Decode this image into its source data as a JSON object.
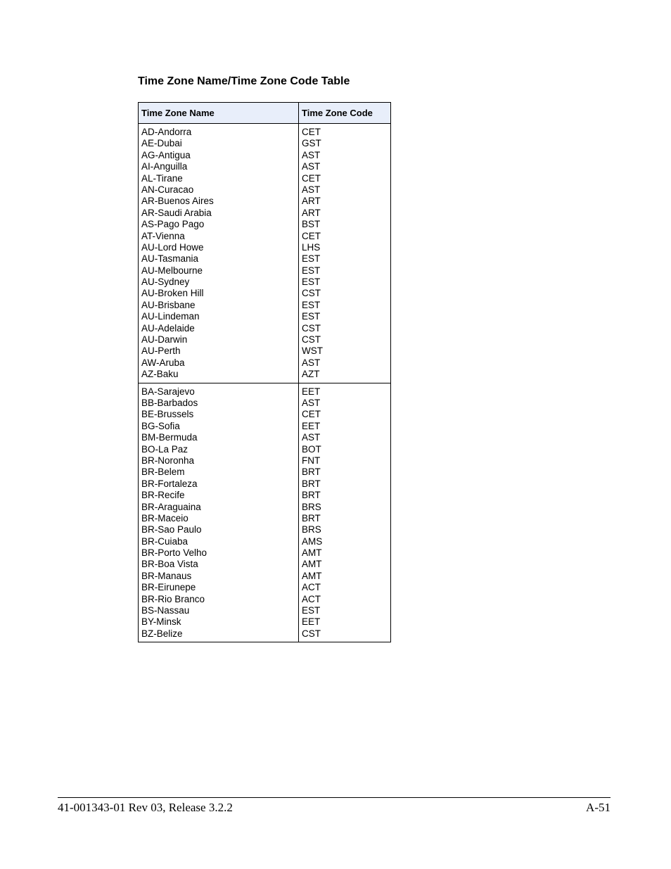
{
  "title": "Time Zone Name/Time Zone Code Table",
  "table": {
    "headers": [
      "Time Zone Name",
      "Time Zone Code"
    ],
    "groups": [
      {
        "rows": [
          {
            "name": "AD-Andorra",
            "code": "CET"
          },
          {
            "name": "AE-Dubai",
            "code": "GST"
          },
          {
            "name": "AG-Antigua",
            "code": "AST"
          },
          {
            "name": "AI-Anguilla",
            "code": "AST"
          },
          {
            "name": "AL-Tirane",
            "code": "CET"
          },
          {
            "name": "AN-Curacao",
            "code": "AST"
          },
          {
            "name": "AR-Buenos Aires",
            "code": "ART"
          },
          {
            "name": "AR-Saudi Arabia",
            "code": "ART"
          },
          {
            "name": "AS-Pago Pago",
            "code": "BST"
          },
          {
            "name": "AT-Vienna",
            "code": "CET"
          },
          {
            "name": "AU-Lord Howe",
            "code": "LHS"
          },
          {
            "name": "AU-Tasmania",
            "code": "EST"
          },
          {
            "name": "AU-Melbourne",
            "code": "EST"
          },
          {
            "name": "AU-Sydney",
            "code": "EST"
          },
          {
            "name": "AU-Broken Hill",
            "code": "CST"
          },
          {
            "name": "AU-Brisbane",
            "code": "EST"
          },
          {
            "name": "AU-Lindeman",
            "code": "EST"
          },
          {
            "name": "AU-Adelaide",
            "code": "CST"
          },
          {
            "name": "AU-Darwin",
            "code": "CST"
          },
          {
            "name": "AU-Perth",
            "code": "WST"
          },
          {
            "name": "AW-Aruba",
            "code": "AST"
          },
          {
            "name": "AZ-Baku",
            "code": "AZT"
          }
        ]
      },
      {
        "rows": [
          {
            "name": "BA-Sarajevo",
            "code": "EET"
          },
          {
            "name": "BB-Barbados",
            "code": "AST"
          },
          {
            "name": "BE-Brussels",
            "code": "CET"
          },
          {
            "name": "BG-Sofia",
            "code": "EET"
          },
          {
            "name": "BM-Bermuda",
            "code": "AST"
          },
          {
            "name": "BO-La Paz",
            "code": "BOT"
          },
          {
            "name": "BR-Noronha",
            "code": "FNT"
          },
          {
            "name": "BR-Belem",
            "code": "BRT"
          },
          {
            "name": "BR-Fortaleza",
            "code": "BRT"
          },
          {
            "name": "BR-Recife",
            "code": "BRT"
          },
          {
            "name": "BR-Araguaina",
            "code": "BRS"
          },
          {
            "name": "BR-Maceio",
            "code": "BRT"
          },
          {
            "name": "BR-Sao Paulo",
            "code": "BRS"
          },
          {
            "name": "BR-Cuiaba",
            "code": "AMS"
          },
          {
            "name": "BR-Porto Velho",
            "code": "AMT"
          },
          {
            "name": "BR-Boa Vista",
            "code": "AMT"
          },
          {
            "name": "BR-Manaus",
            "code": "AMT"
          },
          {
            "name": "BR-Eirunepe",
            "code": "ACT"
          },
          {
            "name": "BR-Rio Branco",
            "code": "ACT"
          },
          {
            "name": "BS-Nassau",
            "code": "EST"
          },
          {
            "name": "BY-Minsk",
            "code": "EET"
          },
          {
            "name": "BZ-Belize",
            "code": "CST"
          }
        ]
      }
    ]
  },
  "footer": {
    "doc_id": "41-001343-01 Rev 03, Release 3.2.2",
    "page_number": "A-51"
  },
  "colors": {
    "header_bg": "#e8eefa"
  }
}
